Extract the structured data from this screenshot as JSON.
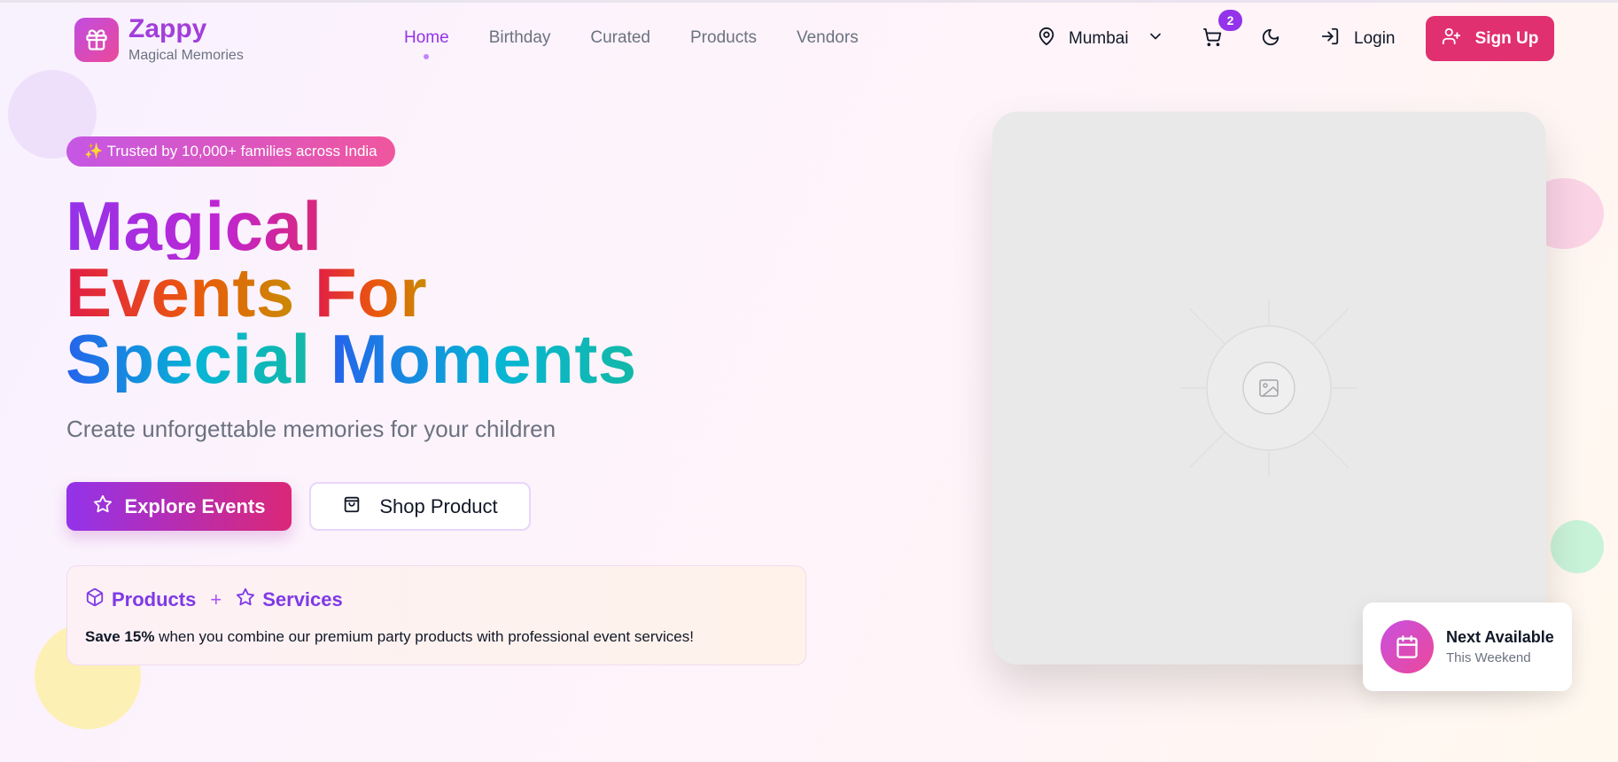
{
  "brand": {
    "name": "Zappy",
    "tagline": "Magical Memories"
  },
  "nav": {
    "items": [
      {
        "label": "Home",
        "active": true
      },
      {
        "label": "Birthday",
        "active": false
      },
      {
        "label": "Curated",
        "active": false
      },
      {
        "label": "Products",
        "active": false
      },
      {
        "label": "Vendors",
        "active": false
      }
    ]
  },
  "header": {
    "location": "Mumbai",
    "cart_count": "2",
    "login_label": "Login",
    "signup_label": "Sign Up"
  },
  "hero": {
    "trust_badge": "✨ Trusted by 10,000+ families across India",
    "headline": {
      "line1": "Magical",
      "line2a": "Events",
      "line2b": "For",
      "line3a": "Special",
      "line3b": "Moments"
    },
    "subtitle": "Create unforgettable memories for your children",
    "explore_label": "Explore Events",
    "shop_label": "Shop Product"
  },
  "combo": {
    "products_label": "Products",
    "plus": "+",
    "services_label": "Services",
    "save_text": "Save 15%",
    "desc_text": " when you combine our premium party products with professional event services!"
  },
  "availability": {
    "title": "Next Available",
    "subtitle": "This Weekend"
  },
  "icons": [
    "gift-icon",
    "map-pin-icon",
    "chevron-down-icon",
    "cart-icon",
    "moon-icon",
    "login-icon",
    "user-plus-icon",
    "star-icon",
    "shopping-bag-icon",
    "box-icon",
    "image-icon",
    "calendar-icon"
  ],
  "colors": {
    "brand_purple": "#9333ea",
    "signup_pink": "#e0306f",
    "text_gray": "#6b7280"
  }
}
